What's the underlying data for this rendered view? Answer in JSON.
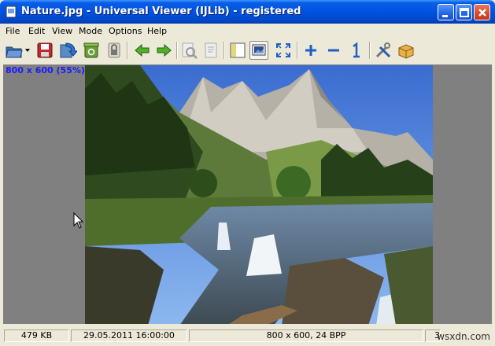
{
  "window": {
    "title": "Nature.jpg - Universal Viewer (IJLib) - registered"
  },
  "menu": [
    "File",
    "Edit",
    "View",
    "Mode",
    "Options",
    "Help"
  ],
  "toolbar": {
    "buttons": [
      "open-folder-icon",
      "dropdown-arrow-icon",
      "save-icon",
      "copy-move-icon",
      "recycle-icon",
      "lock-icon",
      "arrow-prev-icon",
      "arrow-next-icon",
      "find-icon",
      "page-icon",
      "panel-icon",
      "fit-window-icon",
      "fullscreen-icon",
      "zoom-in-icon",
      "zoom-out-icon",
      "original-size-icon",
      "tools-icon",
      "plugin-icon"
    ]
  },
  "viewer": {
    "image_info": "800 x 600 (55%)"
  },
  "status": {
    "size": "479 KB",
    "date": "29.05.2011 16:00:00",
    "format": "800 x 600, 24 BPP",
    "page": "3"
  },
  "watermark": "wsxdn.com",
  "colors": {
    "titlebar": "#0054e3",
    "info_text": "#1c1cff",
    "chrome": "#ece9d8"
  }
}
